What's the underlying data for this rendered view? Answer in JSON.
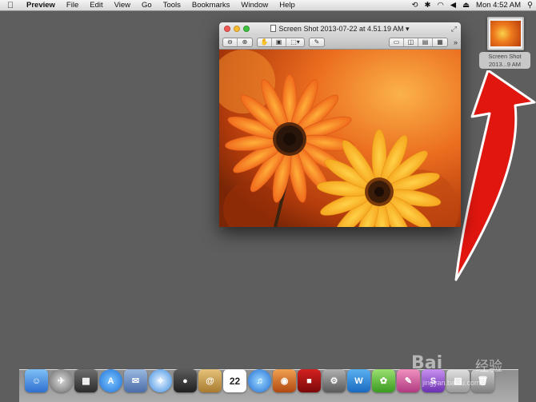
{
  "menubar": {
    "apple": "",
    "items": [
      "Preview",
      "File",
      "Edit",
      "View",
      "Go",
      "Tools",
      "Bookmarks",
      "Window",
      "Help"
    ],
    "clock": "Mon 4:52 AM"
  },
  "window": {
    "title": "Screen Shot 2013-07-22 at 4.51.19 AM",
    "title_arrow": "▾"
  },
  "desktop_file": {
    "label_line1": "Screen Shot",
    "label_line2": "2013...9 AM"
  },
  "dock": {
    "calendar_date": "22"
  },
  "watermark": {
    "brand": "Bai",
    "brand_cn": "经验",
    "url": "jingyan.baidu.com"
  },
  "colors": {
    "desktop": "#5e5e5e",
    "arrow": "#e0160f",
    "flower_center": "#2a160a"
  }
}
